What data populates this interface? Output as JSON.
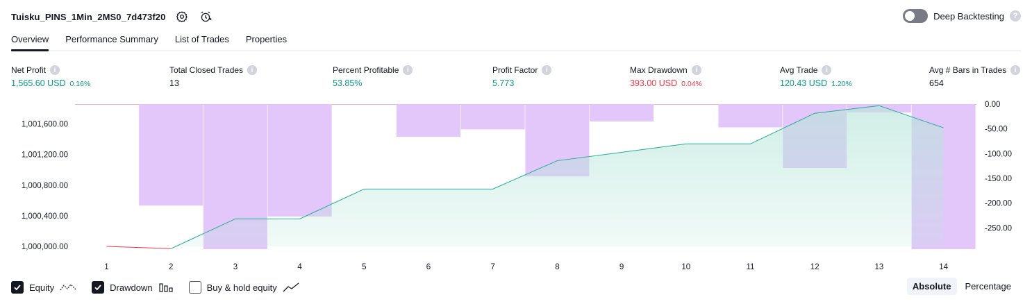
{
  "header": {
    "strategy_name": "Tuisku_PINS_1Min_2MS0_7d473f20",
    "deep_backtesting_label": "Deep Backtesting",
    "deep_backtesting_enabled": false
  },
  "tabs": [
    {
      "label": "Overview",
      "active": true
    },
    {
      "label": "Performance Summary",
      "active": false
    },
    {
      "label": "List of Trades",
      "active": false
    },
    {
      "label": "Properties",
      "active": false
    }
  ],
  "metrics": {
    "net_profit": {
      "label": "Net Profit",
      "value": "1,565.60 USD",
      "sub": "0.16%"
    },
    "total_closed_trades": {
      "label": "Total Closed Trades",
      "value": "13"
    },
    "percent_profitable": {
      "label": "Percent Profitable",
      "value": "53.85%"
    },
    "profit_factor": {
      "label": "Profit Factor",
      "value": "5.773"
    },
    "max_drawdown": {
      "label": "Max Drawdown",
      "value": "393.00 USD",
      "sub": "0.04%"
    },
    "avg_trade": {
      "label": "Avg Trade",
      "value": "120.43 USD",
      "sub": "1.20%"
    },
    "avg_bars": {
      "label": "Avg # Bars in Trades",
      "value": "654"
    }
  },
  "chart_data": {
    "type": "area",
    "x": [
      1,
      2,
      3,
      4,
      5,
      6,
      7,
      8,
      9,
      10,
      11,
      12,
      13,
      14
    ],
    "left_axis_ticks": [
      "1,001,600.00",
      "1,001,200.00",
      "1,000,800.00",
      "1,000,400.00",
      "1,000,000.00"
    ],
    "right_axis_ticks": [
      "0.00",
      "-50.00",
      "-100.00",
      "-150.00",
      "-200.00",
      "-250.00"
    ],
    "equity": {
      "name": "Equity",
      "x": [
        1,
        2,
        3,
        4,
        5,
        7,
        8,
        10,
        11,
        12,
        13,
        14
      ],
      "values": [
        1000000,
        999970,
        1000360,
        1000360,
        1000750,
        1000750,
        1001120,
        1001340,
        1001340,
        1001740,
        1001840,
        1001550
      ]
    },
    "drawdown": {
      "name": "Drawdown",
      "bars": [
        {
          "x": 1,
          "value": 0
        },
        {
          "x": 2,
          "value": -205
        },
        {
          "x": 3,
          "value": -293
        },
        {
          "x": 4,
          "value": -227
        },
        {
          "x": 5,
          "value": 0
        },
        {
          "x": 6,
          "value": -66
        },
        {
          "x": 7,
          "value": -51
        },
        {
          "x": 8,
          "value": -146
        },
        {
          "x": 9,
          "value": -35
        },
        {
          "x": 10,
          "value": 0
        },
        {
          "x": 11,
          "value": -47
        },
        {
          "x": 12,
          "value": -129
        },
        {
          "x": 13,
          "value": -17
        },
        {
          "x": 14,
          "value": -293
        }
      ]
    },
    "left_ylim": [
      1000000,
      1001860
    ],
    "right_ylim": [
      -293,
      0
    ],
    "colors": {
      "equity_line_up": "#22ab94",
      "equity_line_down": "#f23645",
      "equity_fill_top": "#b6e5d8",
      "drawdown_bar": "#e1c4fb",
      "drawdown_line": "#f7b3c8"
    }
  },
  "legend": {
    "equity": {
      "label": "Equity",
      "checked": true
    },
    "drawdown": {
      "label": "Drawdown",
      "checked": true
    },
    "buy_hold": {
      "label": "Buy & hold equity",
      "checked": false
    }
  },
  "modes": {
    "absolute": "Absolute",
    "percentage": "Percentage",
    "active": "Absolute"
  }
}
